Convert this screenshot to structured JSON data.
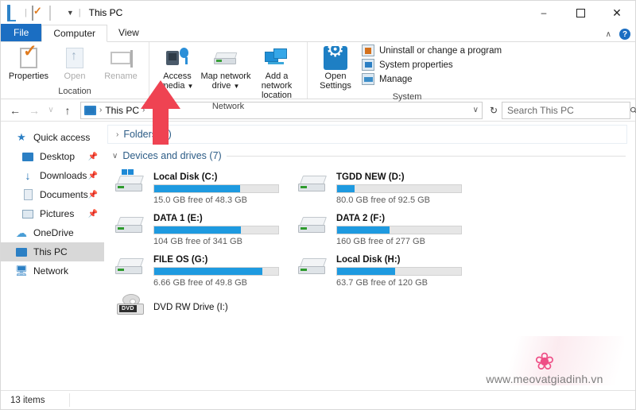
{
  "window": {
    "title": "This PC",
    "quick_access": [
      "pc-icon",
      "properties-icon",
      "blank-icon"
    ],
    "controls": {
      "minimize": "–",
      "maximize": "☐",
      "close": "✕"
    }
  },
  "tabs": [
    {
      "label": "File",
      "state": "file"
    },
    {
      "label": "Computer",
      "state": "active"
    },
    {
      "label": "View",
      "state": "normal"
    }
  ],
  "tab_right": {
    "collapse": "∧",
    "help": "?"
  },
  "ribbon": {
    "groups": [
      {
        "label": "Location",
        "buttons": [
          {
            "label": "Properties",
            "icon": "properties-icon",
            "disabled": false,
            "dropdown": false
          },
          {
            "label": "Open",
            "icon": "open-icon",
            "disabled": true,
            "dropdown": false
          },
          {
            "label": "Rename",
            "icon": "rename-icon",
            "disabled": true,
            "dropdown": false
          }
        ]
      },
      {
        "label": "Network",
        "buttons": [
          {
            "label": "Access media",
            "icon": "access-media-icon",
            "disabled": false,
            "dropdown": true
          },
          {
            "label": "Map network drive",
            "icon": "map-network-drive-icon",
            "disabled": false,
            "dropdown": true
          },
          {
            "label": "Add a network location",
            "icon": "add-network-location-icon",
            "disabled": false,
            "dropdown": false
          }
        ]
      },
      {
        "label": "System",
        "big_button": {
          "label_line1": "Open",
          "label_line2": "Settings",
          "icon": "gear-icon"
        },
        "items": [
          {
            "label": "Uninstall or change a program",
            "icon": "uninstall-icon"
          },
          {
            "label": "System properties",
            "icon": "system-properties-icon"
          },
          {
            "label": "Manage",
            "icon": "manage-icon"
          }
        ]
      }
    ]
  },
  "address_bar": {
    "back": "←",
    "forward": "→",
    "recent": "∨",
    "up": "↑",
    "breadcrumb_icon": "this-pc-icon",
    "breadcrumb": "This PC",
    "separator": "›",
    "dropdown_caret": "∨",
    "refresh": "↻",
    "search_placeholder": "Search This PC",
    "search_value": "",
    "search_icon": "search-icon"
  },
  "sidebar": {
    "items": [
      {
        "label": "Quick access",
        "icon": "star-icon",
        "level": 0,
        "pinned": false,
        "selected": false
      },
      {
        "label": "Desktop",
        "icon": "desktop-icon",
        "level": 1,
        "pinned": true,
        "selected": false
      },
      {
        "label": "Downloads",
        "icon": "downloads-icon",
        "level": 1,
        "pinned": true,
        "selected": false
      },
      {
        "label": "Documents",
        "icon": "documents-icon",
        "level": 1,
        "pinned": true,
        "selected": false
      },
      {
        "label": "Pictures",
        "icon": "pictures-icon",
        "level": 1,
        "pinned": true,
        "selected": false
      },
      {
        "label": "OneDrive",
        "icon": "cloud-icon",
        "level": 0,
        "pinned": false,
        "selected": false
      },
      {
        "label": "This PC",
        "icon": "this-pc-icon",
        "level": 0,
        "pinned": false,
        "selected": true
      },
      {
        "label": "Network",
        "icon": "network-icon",
        "level": 0,
        "pinned": false,
        "selected": false
      }
    ],
    "pin_glyph": "📌"
  },
  "content": {
    "groups": [
      {
        "label": "Folders (6)",
        "collapsed": true,
        "chevron": "›"
      },
      {
        "label": "Devices and drives (7)",
        "collapsed": false,
        "chevron": "∨"
      }
    ],
    "drives": [
      {
        "name": "Local Disk (C:)",
        "free": "15.0 GB free of 48.3 GB",
        "fill_pct": 69,
        "fill_color": "#1e9ae0",
        "icon": "windows-drive-icon"
      },
      {
        "name": "TGDD NEW (D:)",
        "free": "80.0 GB free of 92.5 GB",
        "fill_pct": 14,
        "fill_color": "#1e9ae0",
        "icon": "drive-icon"
      },
      {
        "name": "DATA 1 (E:)",
        "free": "104 GB free of 341 GB",
        "fill_pct": 70,
        "fill_color": "#1e9ae0",
        "icon": "drive-icon"
      },
      {
        "name": "DATA 2 (F:)",
        "free": "160 GB free of 277 GB",
        "fill_pct": 42,
        "fill_color": "#1e9ae0",
        "icon": "drive-icon"
      },
      {
        "name": "FILE OS (G:)",
        "free": "6.66 GB free of 49.8 GB",
        "fill_pct": 87,
        "fill_color": "#1e9ae0",
        "icon": "drive-icon"
      },
      {
        "name": "Local Disk (H:)",
        "free": "63.7 GB free of 120 GB",
        "fill_pct": 47,
        "fill_color": "#1e9ae0",
        "icon": "drive-icon"
      }
    ],
    "optical_drive": {
      "name": "DVD RW Drive (I:)",
      "label": "DVD",
      "icon": "dvd-drive-icon"
    }
  },
  "status_bar": {
    "item_count": "13 items"
  },
  "annotation": {
    "type": "red-up-arrow",
    "points_to": "Map network drive",
    "color": "#ef4352"
  },
  "watermark": {
    "logo": "lotus-logo",
    "text": "www.meovatgiadinh.vn",
    "color": "#ee4f86"
  }
}
